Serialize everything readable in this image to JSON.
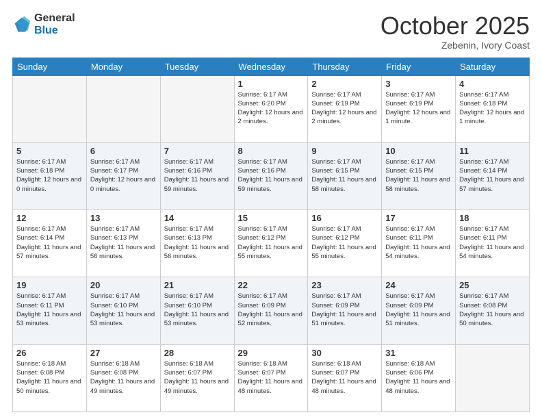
{
  "header": {
    "logo_general": "General",
    "logo_blue": "Blue",
    "month_title": "October 2025",
    "subtitle": "Zebenin, Ivory Coast"
  },
  "days_of_week": [
    "Sunday",
    "Monday",
    "Tuesday",
    "Wednesday",
    "Thursday",
    "Friday",
    "Saturday"
  ],
  "weeks": [
    [
      {
        "day": "",
        "empty": true
      },
      {
        "day": "",
        "empty": true
      },
      {
        "day": "",
        "empty": true
      },
      {
        "day": "1",
        "sunrise": "6:17 AM",
        "sunset": "6:20 PM",
        "daylight": "12 hours and 2 minutes."
      },
      {
        "day": "2",
        "sunrise": "6:17 AM",
        "sunset": "6:19 PM",
        "daylight": "12 hours and 2 minutes."
      },
      {
        "day": "3",
        "sunrise": "6:17 AM",
        "sunset": "6:19 PM",
        "daylight": "12 hours and 1 minute."
      },
      {
        "day": "4",
        "sunrise": "6:17 AM",
        "sunset": "6:18 PM",
        "daylight": "12 hours and 1 minute."
      }
    ],
    [
      {
        "day": "5",
        "sunrise": "6:17 AM",
        "sunset": "6:18 PM",
        "daylight": "12 hours and 0 minutes."
      },
      {
        "day": "6",
        "sunrise": "6:17 AM",
        "sunset": "6:17 PM",
        "daylight": "12 hours and 0 minutes."
      },
      {
        "day": "7",
        "sunrise": "6:17 AM",
        "sunset": "6:16 PM",
        "daylight": "11 hours and 59 minutes."
      },
      {
        "day": "8",
        "sunrise": "6:17 AM",
        "sunset": "6:16 PM",
        "daylight": "11 hours and 59 minutes."
      },
      {
        "day": "9",
        "sunrise": "6:17 AM",
        "sunset": "6:15 PM",
        "daylight": "11 hours and 58 minutes."
      },
      {
        "day": "10",
        "sunrise": "6:17 AM",
        "sunset": "6:15 PM",
        "daylight": "11 hours and 58 minutes."
      },
      {
        "day": "11",
        "sunrise": "6:17 AM",
        "sunset": "6:14 PM",
        "daylight": "11 hours and 57 minutes."
      }
    ],
    [
      {
        "day": "12",
        "sunrise": "6:17 AM",
        "sunset": "6:14 PM",
        "daylight": "11 hours and 57 minutes."
      },
      {
        "day": "13",
        "sunrise": "6:17 AM",
        "sunset": "6:13 PM",
        "daylight": "11 hours and 56 minutes."
      },
      {
        "day": "14",
        "sunrise": "6:17 AM",
        "sunset": "6:13 PM",
        "daylight": "11 hours and 56 minutes."
      },
      {
        "day": "15",
        "sunrise": "6:17 AM",
        "sunset": "6:12 PM",
        "daylight": "11 hours and 55 minutes."
      },
      {
        "day": "16",
        "sunrise": "6:17 AM",
        "sunset": "6:12 PM",
        "daylight": "11 hours and 55 minutes."
      },
      {
        "day": "17",
        "sunrise": "6:17 AM",
        "sunset": "6:11 PM",
        "daylight": "11 hours and 54 minutes."
      },
      {
        "day": "18",
        "sunrise": "6:17 AM",
        "sunset": "6:11 PM",
        "daylight": "11 hours and 54 minutes."
      }
    ],
    [
      {
        "day": "19",
        "sunrise": "6:17 AM",
        "sunset": "6:11 PM",
        "daylight": "11 hours and 53 minutes."
      },
      {
        "day": "20",
        "sunrise": "6:17 AM",
        "sunset": "6:10 PM",
        "daylight": "11 hours and 53 minutes."
      },
      {
        "day": "21",
        "sunrise": "6:17 AM",
        "sunset": "6:10 PM",
        "daylight": "11 hours and 53 minutes."
      },
      {
        "day": "22",
        "sunrise": "6:17 AM",
        "sunset": "6:09 PM",
        "daylight": "11 hours and 52 minutes."
      },
      {
        "day": "23",
        "sunrise": "6:17 AM",
        "sunset": "6:09 PM",
        "daylight": "11 hours and 51 minutes."
      },
      {
        "day": "24",
        "sunrise": "6:17 AM",
        "sunset": "6:09 PM",
        "daylight": "11 hours and 51 minutes."
      },
      {
        "day": "25",
        "sunrise": "6:17 AM",
        "sunset": "6:08 PM",
        "daylight": "11 hours and 50 minutes."
      }
    ],
    [
      {
        "day": "26",
        "sunrise": "6:18 AM",
        "sunset": "6:08 PM",
        "daylight": "11 hours and 50 minutes."
      },
      {
        "day": "27",
        "sunrise": "6:18 AM",
        "sunset": "6:08 PM",
        "daylight": "11 hours and 49 minutes."
      },
      {
        "day": "28",
        "sunrise": "6:18 AM",
        "sunset": "6:07 PM",
        "daylight": "11 hours and 49 minutes."
      },
      {
        "day": "29",
        "sunrise": "6:18 AM",
        "sunset": "6:07 PM",
        "daylight": "11 hours and 48 minutes."
      },
      {
        "day": "30",
        "sunrise": "6:18 AM",
        "sunset": "6:07 PM",
        "daylight": "11 hours and 48 minutes."
      },
      {
        "day": "31",
        "sunrise": "6:18 AM",
        "sunset": "6:06 PM",
        "daylight": "11 hours and 48 minutes."
      },
      {
        "day": "",
        "empty": true
      }
    ]
  ],
  "labels": {
    "sunrise": "Sunrise:",
    "sunset": "Sunset:",
    "daylight": "Daylight:"
  }
}
